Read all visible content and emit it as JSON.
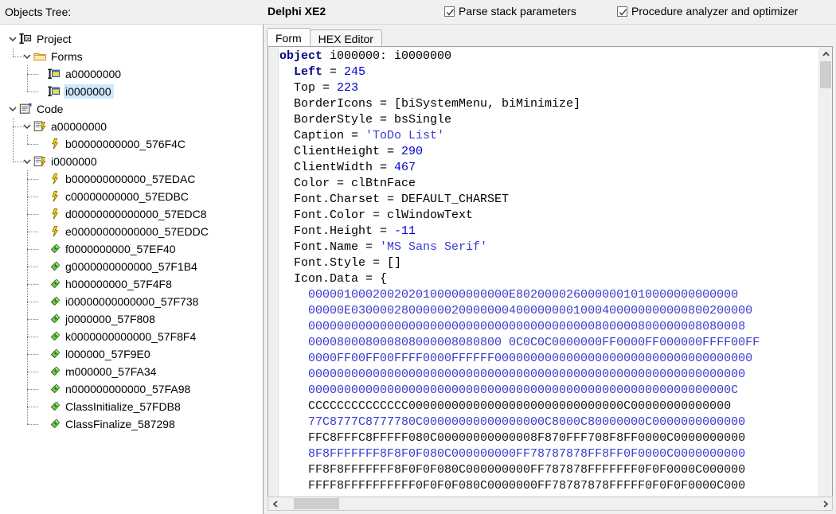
{
  "header": {
    "objects_tree_label": "Objects Tree:",
    "app_title": "Delphi XE2",
    "checkbox_parse": {
      "label": "Parse stack parameters",
      "checked": true
    },
    "checkbox_analyzer": {
      "label": "Procedure analyzer and optimizer",
      "checked": true
    }
  },
  "tree": {
    "nodes": [
      {
        "label": "Project",
        "icon": "delphi-project-icon",
        "depth": 0,
        "expander": "expanded",
        "selected": false
      },
      {
        "label": "Forms",
        "icon": "folder-icon",
        "depth": 1,
        "expander": "expanded",
        "selected": false
      },
      {
        "label": "a00000000",
        "icon": "form-icon",
        "depth": 2,
        "expander": "none",
        "selected": false
      },
      {
        "label": "i0000000",
        "icon": "form-icon",
        "depth": 2,
        "expander": "none",
        "selected": true
      },
      {
        "label": "Code",
        "icon": "code-unit-icon",
        "depth": 0,
        "expander": "expanded",
        "selected": false
      },
      {
        "label": "a00000000",
        "icon": "unit-icon",
        "depth": 1,
        "expander": "expanded",
        "selected": false
      },
      {
        "label": "b00000000000_576F4C",
        "icon": "procedure-icon",
        "depth": 2,
        "expander": "none",
        "selected": false
      },
      {
        "label": "i0000000",
        "icon": "unit-icon",
        "depth": 1,
        "expander": "expanded",
        "selected": false
      },
      {
        "label": "b000000000000_57EDAC",
        "icon": "procedure-icon",
        "depth": 2,
        "expander": "none",
        "selected": false
      },
      {
        "label": "c00000000000_57EDBC",
        "icon": "procedure-icon",
        "depth": 2,
        "expander": "none",
        "selected": false
      },
      {
        "label": "d00000000000000_57EDC8",
        "icon": "procedure-icon",
        "depth": 2,
        "expander": "none",
        "selected": false
      },
      {
        "label": "e00000000000000_57EDDC",
        "icon": "procedure-icon",
        "depth": 2,
        "expander": "none",
        "selected": false
      },
      {
        "label": "f0000000000_57EF40",
        "icon": "method-icon",
        "depth": 2,
        "expander": "none",
        "selected": false
      },
      {
        "label": "g0000000000000_57F1B4",
        "icon": "method-icon",
        "depth": 2,
        "expander": "none",
        "selected": false
      },
      {
        "label": "h000000000_57F4F8",
        "icon": "method-icon",
        "depth": 2,
        "expander": "none",
        "selected": false
      },
      {
        "label": "i00000000000000_57F738",
        "icon": "method-icon",
        "depth": 2,
        "expander": "none",
        "selected": false
      },
      {
        "label": "j0000000_57F808",
        "icon": "method-icon",
        "depth": 2,
        "expander": "none",
        "selected": false
      },
      {
        "label": "k0000000000000_57F8F4",
        "icon": "method-icon",
        "depth": 2,
        "expander": "none",
        "selected": false
      },
      {
        "label": "l000000_57F9E0",
        "icon": "method-icon",
        "depth": 2,
        "expander": "none",
        "selected": false
      },
      {
        "label": "m000000_57FA34",
        "icon": "method-icon",
        "depth": 2,
        "expander": "none",
        "selected": false
      },
      {
        "label": "n000000000000_57FA98",
        "icon": "method-icon",
        "depth": 2,
        "expander": "none",
        "selected": false
      },
      {
        "label": "ClassInitialize_57FDB8",
        "icon": "method-icon",
        "depth": 2,
        "expander": "none",
        "selected": false
      },
      {
        "label": "ClassFinalize_587298",
        "icon": "method-icon",
        "depth": 2,
        "expander": "none",
        "selected": false
      }
    ]
  },
  "editor": {
    "tabs": [
      {
        "label": "Form",
        "active": true
      },
      {
        "label": "HEX Editor",
        "active": false
      }
    ],
    "code_lines": [
      [
        {
          "t": "object ",
          "c": "kw"
        },
        {
          "t": "i000000: i0000000",
          "c": "txt"
        }
      ],
      [
        {
          "t": "  ",
          "c": "txt"
        },
        {
          "t": "Left ",
          "c": "kw"
        },
        {
          "t": "= ",
          "c": "txt"
        },
        {
          "t": "245",
          "c": "num"
        }
      ],
      [
        {
          "t": "  Top = ",
          "c": "txt"
        },
        {
          "t": "223",
          "c": "num"
        }
      ],
      [
        {
          "t": "  BorderIcons = [biSystemMenu, biMinimize]",
          "c": "txt"
        }
      ],
      [
        {
          "t": "  BorderStyle = bsSingle",
          "c": "txt"
        }
      ],
      [
        {
          "t": "  Caption = ",
          "c": "txt"
        },
        {
          "t": "'ToDo List'",
          "c": "str"
        }
      ],
      [
        {
          "t": "  ClientHeight = ",
          "c": "txt"
        },
        {
          "t": "290",
          "c": "num"
        }
      ],
      [
        {
          "t": "  ClientWidth = ",
          "c": "txt"
        },
        {
          "t": "467",
          "c": "num"
        }
      ],
      [
        {
          "t": "  Color = clBtnFace",
          "c": "txt"
        }
      ],
      [
        {
          "t": "  Font.Charset = DEFAULT_CHARSET",
          "c": "txt"
        }
      ],
      [
        {
          "t": "  Font.Color = clWindowText",
          "c": "txt"
        }
      ],
      [
        {
          "t": "  Font.Height = ",
          "c": "txt"
        },
        {
          "t": "-11",
          "c": "num"
        }
      ],
      [
        {
          "t": "  Font.Name = ",
          "c": "txt"
        },
        {
          "t": "'MS Sans Serif'",
          "c": "str"
        }
      ],
      [
        {
          "t": "  Font.Style = []",
          "c": "txt"
        }
      ],
      [
        {
          "t": "  Icon.Data = {",
          "c": "txt"
        }
      ],
      [
        {
          "t": "    0000010002002020100000000000E8020000260000001010000000000000",
          "c": "hexb"
        }
      ],
      [
        {
          "t": "    00000E03000028000000200000004000000001000400000000000800200000",
          "c": "hexb"
        }
      ],
      [
        {
          "t": "    0000000000000000000000000000000000000000800000800000008080008",
          "c": "hexb"
        }
      ],
      [
        {
          "t": "    000080008000808000008080800 0C0C0C0000000FF0000FF000000FFFF00FF",
          "c": "hexb"
        }
      ],
      [
        {
          "t": "    0000FF00FF00FFFF0000FFFFFF000000000000000000000000000000000000",
          "c": "hexb"
        }
      ],
      [
        {
          "t": "    0000000000000000000000000000000000000000000000000000000000000",
          "c": "hexb"
        }
      ],
      [
        {
          "t": "    00000000000000000000000000000000000000000000000000000000000C",
          "c": "hexb"
        }
      ],
      [
        {
          "t": "    CCCCCCCCCCCCCC000000000000000000000000000000C00000000000000",
          "c": "hexk"
        }
      ],
      [
        {
          "t": "    77C8777C8777780C00000000000000000C8000C80000000C0000000000000",
          "c": "hexb"
        }
      ],
      [
        {
          "t": "    FFC8FFFC8FFFFF080C00000000000008F870FFF708F8FF0000C0000000000",
          "c": "hexk"
        }
      ],
      [
        {
          "t": "    8F8FFFFFFF8F8F0F080C000000000FF78787878FF8FF0F0000C0000000000",
          "c": "hexb"
        }
      ],
      [
        {
          "t": "    FF8F8FFFFFFF8F0F0F080C000000000FF787878FFFFFFF0F0F0000C000000",
          "c": "hexk"
        }
      ],
      [
        {
          "t": "    FFFF8FFFFFFFFFF0F0F0F080C0000000FF78787878FFFFF0F0F0F0000C000",
          "c": "hexk"
        }
      ]
    ]
  }
}
